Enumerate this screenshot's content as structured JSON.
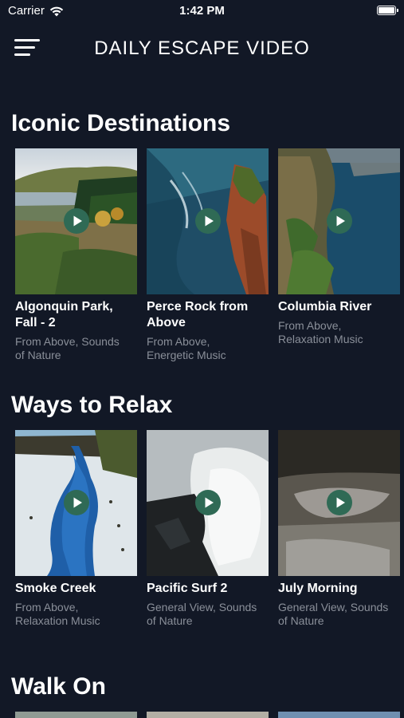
{
  "status_bar": {
    "carrier": "Carrier",
    "time": "1:42 PM"
  },
  "header": {
    "title": "DAILY ESCAPE VIDEO"
  },
  "sections": [
    {
      "title": "Iconic Destinations",
      "cards": [
        {
          "title_line1": "Algonquin Park,",
          "title_line2": "Fall - 2",
          "sub_line1": "From Above, Sounds",
          "sub_line2": "of Nature"
        },
        {
          "title_line1": "Perce Rock from",
          "title_line2": "Above",
          "sub_line1": "From Above,",
          "sub_line2": "Energetic Music"
        },
        {
          "title_line1": "Columbia River",
          "title_line2": "",
          "sub_line1": "From Above,",
          "sub_line2": "Relaxation Music"
        }
      ]
    },
    {
      "title": "Ways to Relax",
      "cards": [
        {
          "title_line1": "Smoke Creek",
          "title_line2": "",
          "sub_line1": "From Above,",
          "sub_line2": "Relaxation Music"
        },
        {
          "title_line1": "Pacific Surf 2",
          "title_line2": "",
          "sub_line1": "General View, Sounds",
          "sub_line2": "of Nature"
        },
        {
          "title_line1": "July Morning",
          "title_line2": "",
          "sub_line1": "General View, Sounds",
          "sub_line2": "of Nature"
        }
      ]
    },
    {
      "title": "Walk On",
      "cards": []
    }
  ],
  "colors": {
    "background": "#121826",
    "play_button": "#2f6a55",
    "subtitle": "#8a8f99"
  },
  "icons": {
    "menu": "hamburger-menu-icon",
    "wifi": "wifi-icon",
    "battery": "battery-icon",
    "play": "play-icon"
  }
}
